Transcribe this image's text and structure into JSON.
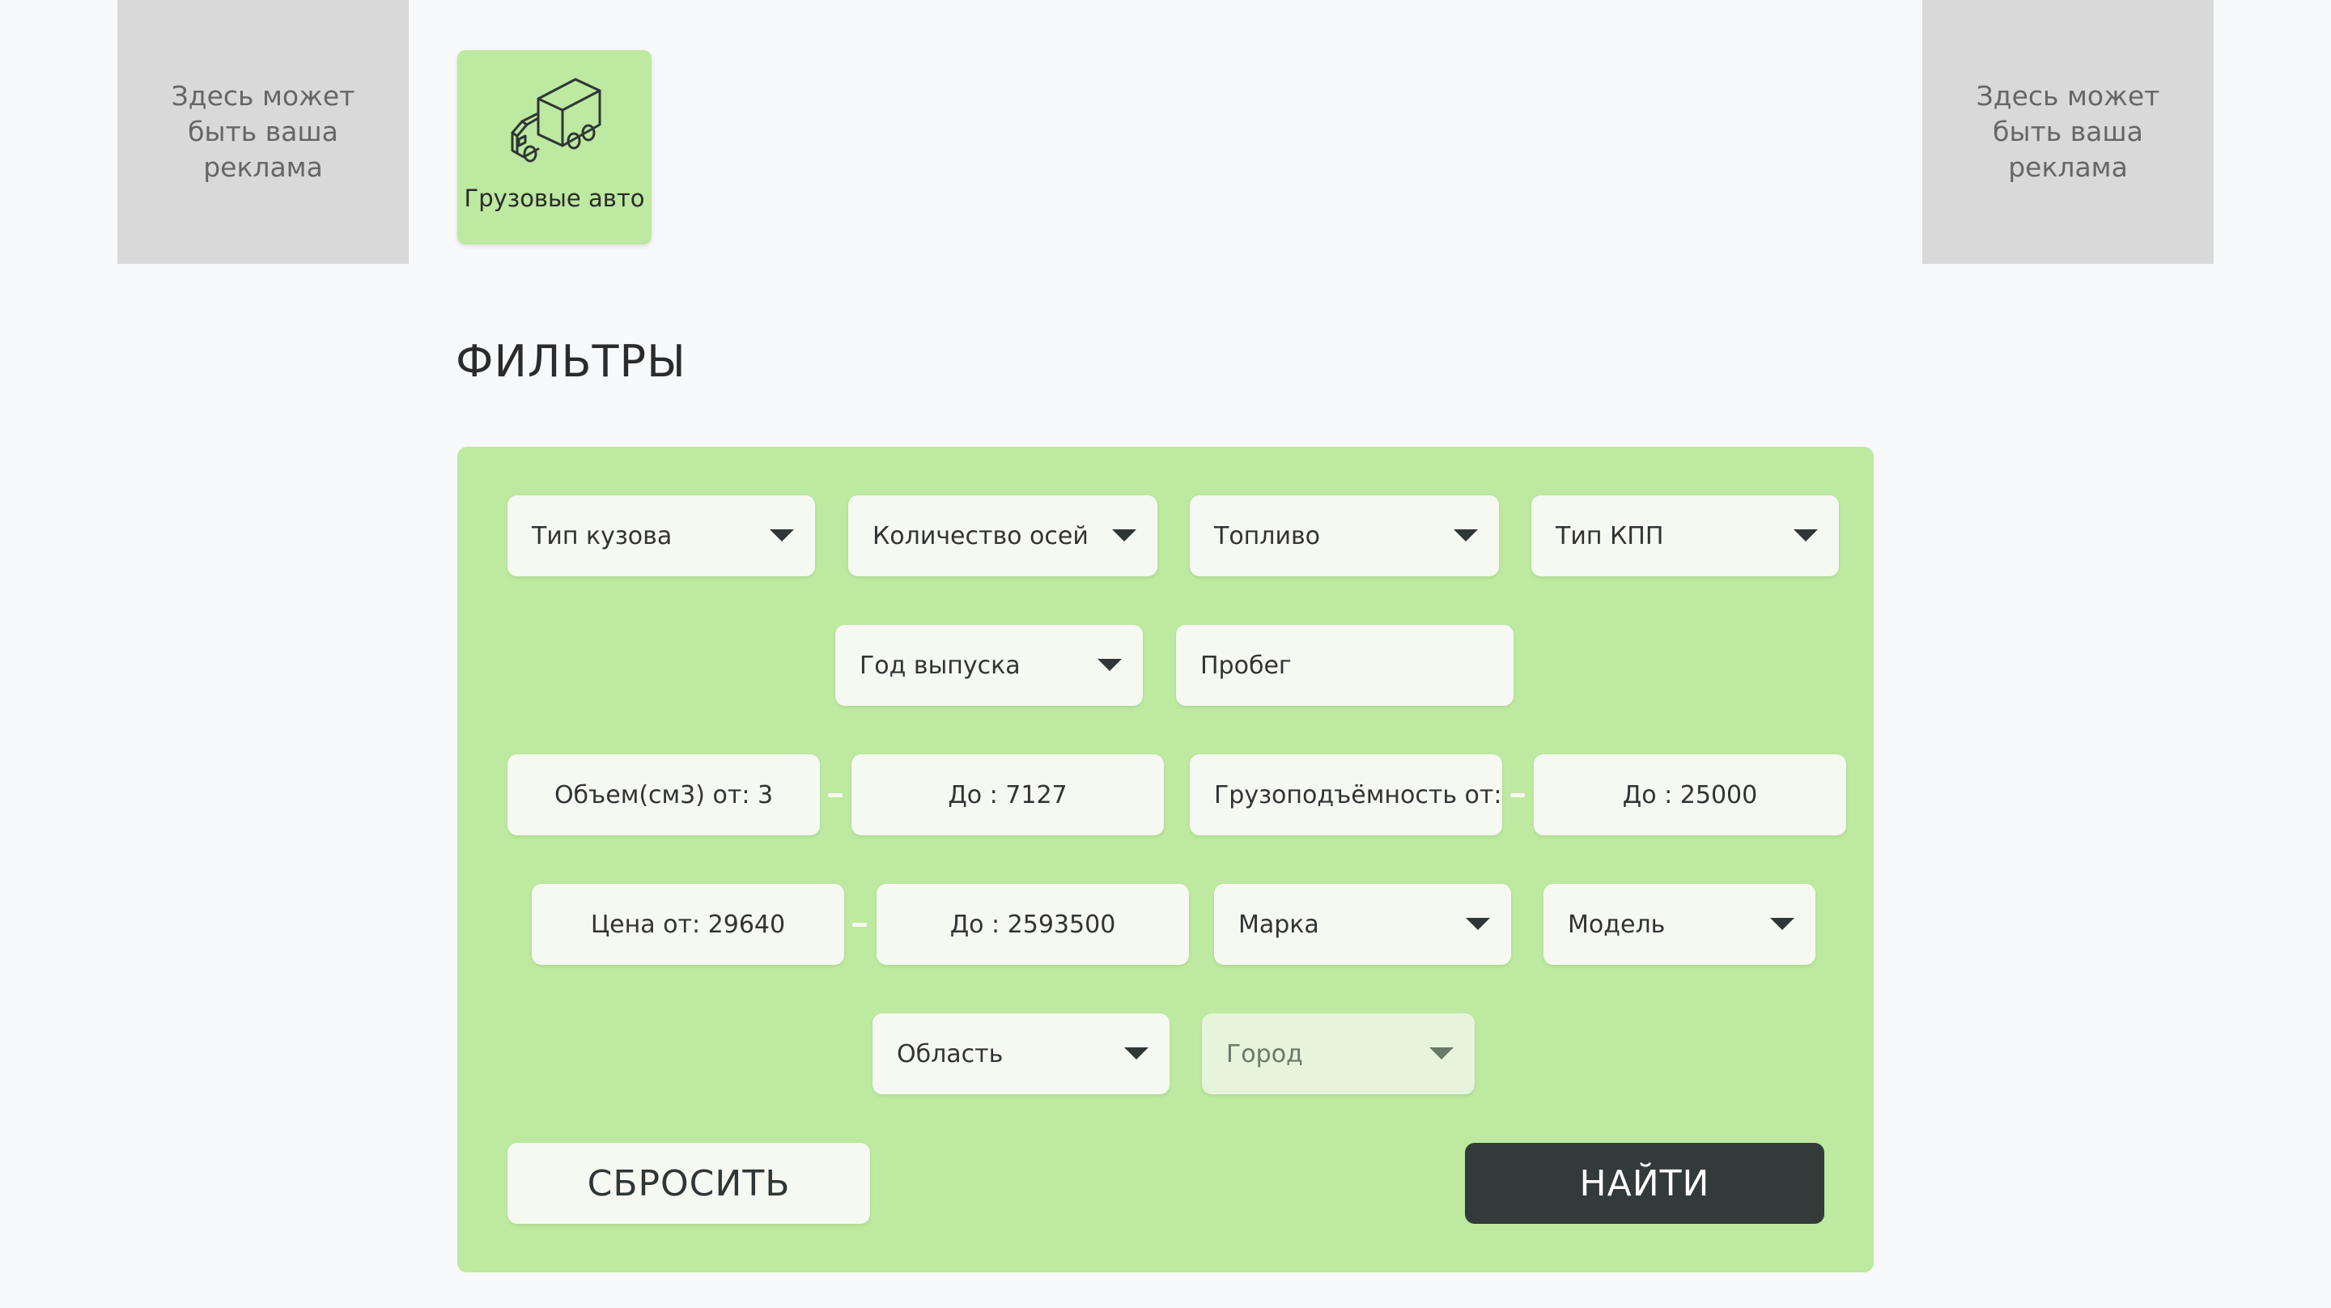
{
  "ads": {
    "left": "Здесь может быть ваша реклама",
    "right": "Здесь может быть ваша реклама"
  },
  "category": {
    "label": "Грузовые авто",
    "icon": "truck-icon",
    "color": "#bde9a0"
  },
  "filters": {
    "title": "ФИЛЬТРЫ",
    "body_type": "Тип кузова",
    "axles": "Количество осей",
    "fuel": "Топливо",
    "gearbox": "Тип КПП",
    "year": "Год выпуска",
    "mileage": "Пробег",
    "volume_from": "Объем(см3) от: 3",
    "volume_to": "До : 7127",
    "capacity_from": "Грузоподъёмность от:",
    "capacity_to": "До : 25000",
    "price_from": "Цена от: 29640",
    "price_to": "До : 2593500",
    "brand": "Марка",
    "model": "Модель",
    "region": "Область",
    "city": "Город"
  },
  "buttons": {
    "reset": "СБРОСИТЬ",
    "find": "НАЙТИ"
  },
  "colors": {
    "panel": "#bde9a0",
    "field": "#f6f8f2",
    "find_button": "#323b39"
  }
}
